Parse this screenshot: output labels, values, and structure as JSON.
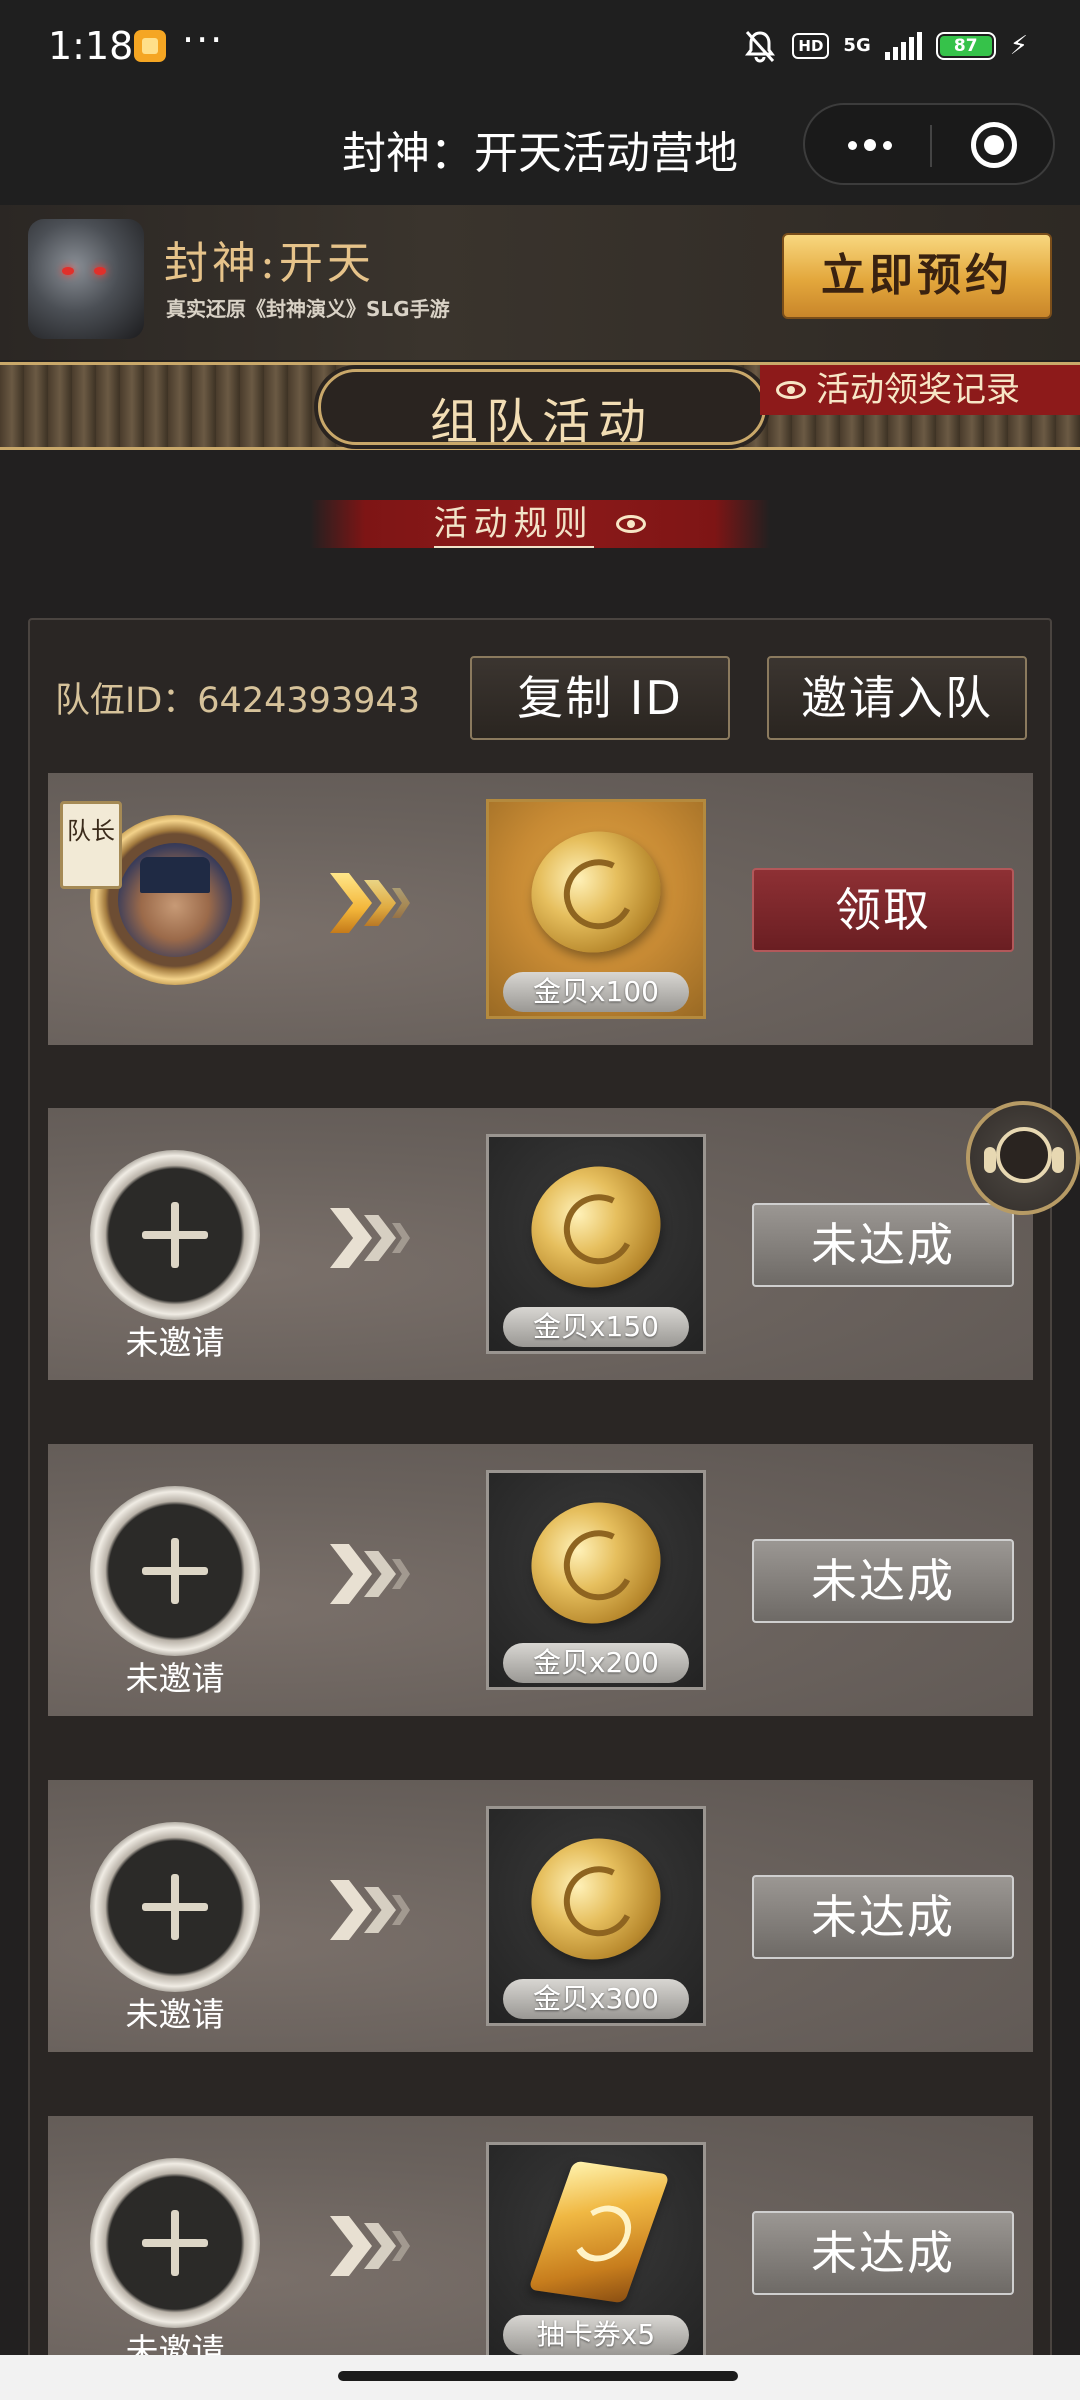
{
  "status_bar": {
    "time": "1:18",
    "more": "···",
    "hd": "HD",
    "network": "5G",
    "battery": "87"
  },
  "title_bar": {
    "title": "封神：开天活动营地"
  },
  "banner": {
    "game_name": "封神:开天",
    "subtitle": "真实还原《封神演义》SLG手游",
    "reserve_label": "立即预约"
  },
  "section": {
    "title": "组队活动",
    "award_record": "活动领奖记录",
    "rules": "活动规则"
  },
  "team": {
    "id_label": "队伍ID：",
    "id_value": "6424393943",
    "copy_label": "复制 ID",
    "invite_label": "邀请入队"
  },
  "rows": [
    {
      "member": "leader",
      "badge": "队长",
      "reward": "金贝x100",
      "reward_icon": "gold-shell-coin",
      "state": "领取"
    },
    {
      "member": "uninvited",
      "member_label": "未邀请",
      "reward": "金贝x150",
      "reward_icon": "gold-shell-coin",
      "state": "未达成"
    },
    {
      "member": "uninvited",
      "member_label": "未邀请",
      "reward": "金贝x200",
      "reward_icon": "gold-shell-coin",
      "state": "未达成"
    },
    {
      "member": "uninvited",
      "member_label": "未邀请",
      "reward": "金贝x300",
      "reward_icon": "gold-shell-coin",
      "state": "未达成"
    },
    {
      "member": "uninvited",
      "member_label": "未邀请",
      "reward": "抽卡券x5",
      "reward_icon": "draw-card-ticket",
      "state": "未达成"
    }
  ],
  "colors": {
    "background": "#222020",
    "accent_gold": "#c9a86a",
    "accent_red": "#8d1a1a",
    "claim_button": "#8e3034"
  }
}
